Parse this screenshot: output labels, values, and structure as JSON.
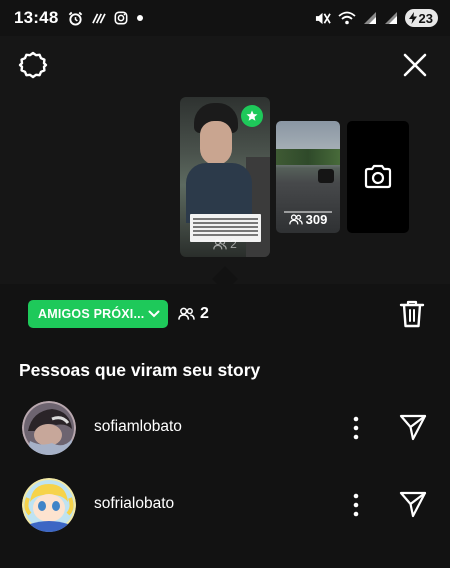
{
  "status_bar": {
    "time": "13:48",
    "battery_level": "23",
    "icons": [
      "alarm-icon",
      "nfc-icon",
      "instagram-icon",
      "notification-dot-icon",
      "mute-icon",
      "wifi-icon",
      "signal-icon",
      "signal-icon",
      "battery-charging-icon"
    ]
  },
  "story": {
    "main_views": "2",
    "second_views": "309",
    "favorite_color": "#1EC95A"
  },
  "controls": {
    "audience_label": "AMIGOS PRÓXI...",
    "audience_count": "2",
    "accent_color": "#1EC95A"
  },
  "viewers": {
    "title": "Pessoas que viram seu story",
    "items": [
      {
        "username": "sofiamlobato"
      },
      {
        "username": "sofrialobato"
      }
    ]
  }
}
